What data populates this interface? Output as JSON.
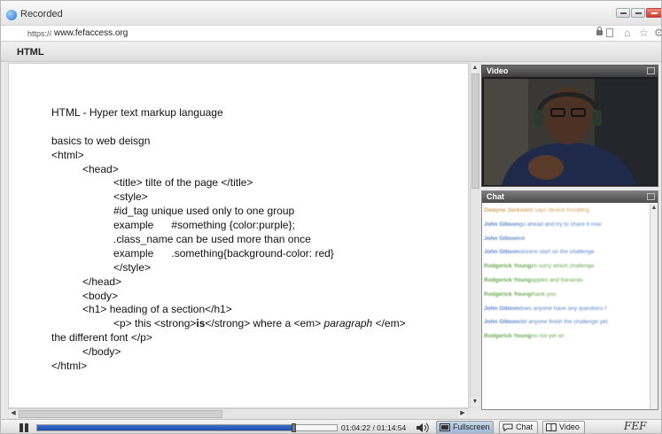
{
  "window": {
    "title": "Recorded"
  },
  "address_bar": {
    "scheme": "https://",
    "host": "www.fefaccess.org"
  },
  "section": {
    "title": "HTML"
  },
  "notes": {
    "heading": "HTML - Hyper text markup language",
    "lines": [
      "basics to web deisgn",
      "<html>",
      "<head>",
      "<title> tilte of the page </title>",
      "<style>",
      "#id_tag unique used only to one group",
      "example      #something {color:purple};",
      ".class_name can be used more than once",
      "example      .something{background-color: red}",
      "</style>",
      "</head>",
      "<body>",
      "<h1> heading of a section</h1>",
      "<p> this <strong>",
      "is",
      "</strong> where a <em> ",
      "paragraph",
      " </em>",
      "the different font </p>",
      "</body>",
      "</html>"
    ]
  },
  "video_panel": {
    "title": "Video"
  },
  "chat_panel": {
    "title": "Chat",
    "messages": [
      {
        "name": "Dwayne Jackson",
        "text": "it says device Installing",
        "color": "#d4a35a"
      },
      {
        "name": "John Gibson",
        "text": "go ahead and try to share it now",
        "color": "#5b86c9"
      },
      {
        "name": "John Gibson",
        "text": "ok",
        "color": "#5b86c9"
      },
      {
        "name": "John Gibson",
        "text": "sincere start on the challenge",
        "color": "#5b86c9"
      },
      {
        "name": "Rodgerick Young",
        "text": "im sorry which challenge",
        "color": "#6aa84f"
      },
      {
        "name": "Rodgerick Young",
        "text": "apples and bananas",
        "color": "#6aa84f"
      },
      {
        "name": "Rodgerick Young",
        "text": "thank you",
        "color": "#6aa84f"
      },
      {
        "name": "John Gibson",
        "text": "does anyone have any questions f",
        "color": "#5b86c9"
      },
      {
        "name": "John Gibson",
        "text": "did anyone finish the challenge yet",
        "color": "#5b86c9"
      },
      {
        "name": "Rodgerick Young",
        "text": "no not yet sir",
        "color": "#6aa84f"
      }
    ]
  },
  "player": {
    "time": "01:04:22 / 01:14:54",
    "progress_fraction": 0.859,
    "fullscreen_label": "Fullscreen",
    "chat_label": "Chat",
    "video_label": "Video",
    "logo": "FEF"
  }
}
